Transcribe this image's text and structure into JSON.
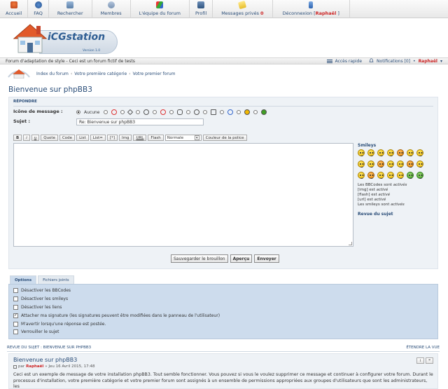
{
  "nav": {
    "items": [
      {
        "label": "Accueil",
        "icon": "home-icon"
      },
      {
        "label": "FAQ",
        "icon": "faq-icon"
      },
      {
        "label": "Rechercher",
        "icon": "search-icon"
      },
      {
        "label": "Membres",
        "icon": "members-icon"
      },
      {
        "label": "L'équipe du forum",
        "icon": "team-icon"
      },
      {
        "label": "Profil",
        "icon": "profile-icon"
      },
      {
        "label": "Messages privés",
        "count": "0",
        "icon": "messages-icon"
      },
      {
        "label": "Déconnexion [",
        "user": "Raphaël",
        "suffix": " ]",
        "icon": "logout-icon"
      }
    ]
  },
  "logo": {
    "text": "iCGstation",
    "version": "Version 1.0"
  },
  "subheader": {
    "description": "Forum d'adaptation de style - Ceci est un forum fictif de tests",
    "quick_access": "Accès rapide",
    "notifications": "Notifications",
    "notif_count": "[0]",
    "bullet": "•",
    "user": "Raphaël",
    "user_arrow": "▾"
  },
  "breadcrumbs": {
    "items": [
      "Index du forum",
      "Votre première catégorie",
      "Votre premier forum"
    ],
    "separator": "‹"
  },
  "page_title": "Bienvenue sur phpBB3",
  "reply": {
    "heading": "RÉPONDRE",
    "icon_label": "Icône de message :",
    "icon_none": "Aucune",
    "subject_label": "Sujet :",
    "subject_value": "Re: Bienvenue sur phpBB3"
  },
  "toolbar": {
    "buttons": [
      "B",
      "i",
      "u",
      "Quote",
      "Code",
      "List",
      "List=",
      "[*]",
      "Img",
      "URL",
      "Flash"
    ],
    "size_value": "Normale",
    "color_button": "Couleur de la police"
  },
  "side": {
    "smileys_title": "Smileys",
    "bbcodes": "Les BBCodes sont ",
    "bbcodes_state": "activés",
    "img": "[img] est ",
    "img_state": "activé",
    "flash": "[flash] est ",
    "flash_state": "activé",
    "url": "[url] est ",
    "url_state": "activé",
    "smileys": "Les smileys sont ",
    "smileys_state": "activés",
    "review_link": "Revue du sujet"
  },
  "actions": {
    "save_draft": "Sauvegarder le brouillon",
    "preview": "Aperçu",
    "submit": "Envoyer"
  },
  "tabs": {
    "options": "Options",
    "attachments": "Fichiers joints"
  },
  "options": [
    {
      "label": "Désactiver les BBCodes",
      "checked": false
    },
    {
      "label": "Désactiver les smileys",
      "checked": false
    },
    {
      "label": "Désactiver les liens",
      "checked": false
    },
    {
      "label": "Attacher ma signature (les signatures peuvent être modifiées dans le panneau de l'utilisateur)",
      "checked": true
    },
    {
      "label": "M'avertir lorsqu'une réponse est postée.",
      "checked": false
    },
    {
      "label": "Verrouiller le sujet",
      "checked": false
    }
  ],
  "review": {
    "heading": "REVUE DU SUJET : BIENVENUE SUR PHPBB3",
    "expand": "ÉTENDRE LA VUE",
    "post_title": "Bienvenue sur phpBB3",
    "post_by": "par",
    "post_author": "Raphaël",
    "post_date": "» Jeu 16 Avril 2015, 17:48",
    "info_button": "i",
    "quote_button": "❝",
    "post_body": "Ceci est un exemple de message de votre installation phpBB3. Tout semble fonctionner. Vous pouvez si vous le voulez supprimer ce message et continuer à configurer votre forum. Durant le processus d'installation, votre première catégorie et votre premier forum sont assignés à un ensemble de permissions appropriées aux groupes d'utilisateurs que sont les administrateurs, les"
  },
  "colors": {
    "link": "#2a4d78",
    "user": "#cc2222",
    "panel": "#eef2f6",
    "options_bg": "#cddced"
  }
}
